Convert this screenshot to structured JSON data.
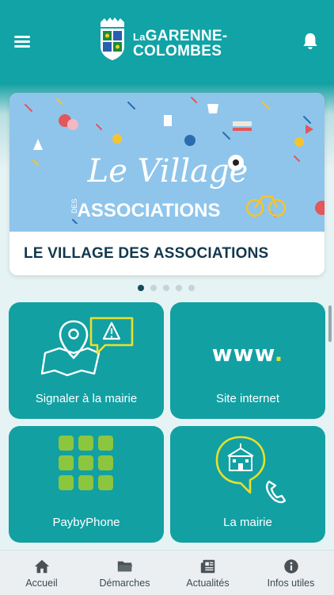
{
  "header": {
    "logo_line1_prefix": "La",
    "logo_line1": "GARENNE-",
    "logo_line2": "COLOMBES"
  },
  "carousel": {
    "slide_image_title_line1": "Le Village",
    "slide_image_title_small": "DES",
    "slide_image_title_line2": "ASSOCIATIONS",
    "slide_caption": "LE VILLAGE DES ASSOCIATIONS",
    "page_count": 5,
    "active_page": 1
  },
  "tiles": [
    {
      "label": "Signaler à la mairie",
      "icon": "map-alert-icon"
    },
    {
      "label": "Site internet",
      "icon_text": "www",
      "icon_dot": "."
    },
    {
      "label": "PaybyPhone",
      "icon": "grid-icon"
    },
    {
      "label": "La mairie",
      "icon": "town-hall-phone-icon"
    }
  ],
  "tabbar": {
    "items": [
      {
        "label": "Accueil",
        "icon": "home-icon"
      },
      {
        "label": "Démarches",
        "icon": "folder-icon"
      },
      {
        "label": "Actualités",
        "icon": "newspaper-icon"
      },
      {
        "label": "Infos utiles",
        "icon": "info-icon"
      }
    ]
  },
  "colors": {
    "primary": "#11a3a6",
    "tile": "#12a0a3",
    "accent_yellow": "#e8e02c",
    "caption_text": "#13384d"
  }
}
